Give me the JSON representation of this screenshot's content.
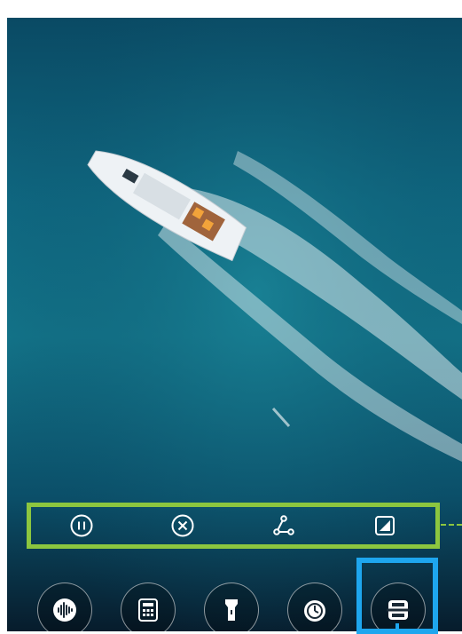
{
  "wallpaper": {
    "subject": "aerial-speedboat-on-teal-sea",
    "colors": {
      "sea_light": "#137489",
      "sea_dark": "#0a4a64",
      "boat": "#e9eef2",
      "wake": "#ffffff"
    }
  },
  "action_bar": {
    "outline_color": "#8cc63f",
    "buttons": [
      {
        "icon": "pause-icon"
      },
      {
        "icon": "close-icon"
      },
      {
        "icon": "share-icon"
      },
      {
        "icon": "image-icon"
      }
    ]
  },
  "dock": {
    "apps": [
      {
        "icon": "voice-recorder-icon"
      },
      {
        "icon": "calculator-icon"
      },
      {
        "icon": "flashlight-icon"
      },
      {
        "icon": "timer-icon"
      },
      {
        "icon": "screenshot-icon"
      }
    ],
    "highlight_color": "#1ea6ee"
  }
}
